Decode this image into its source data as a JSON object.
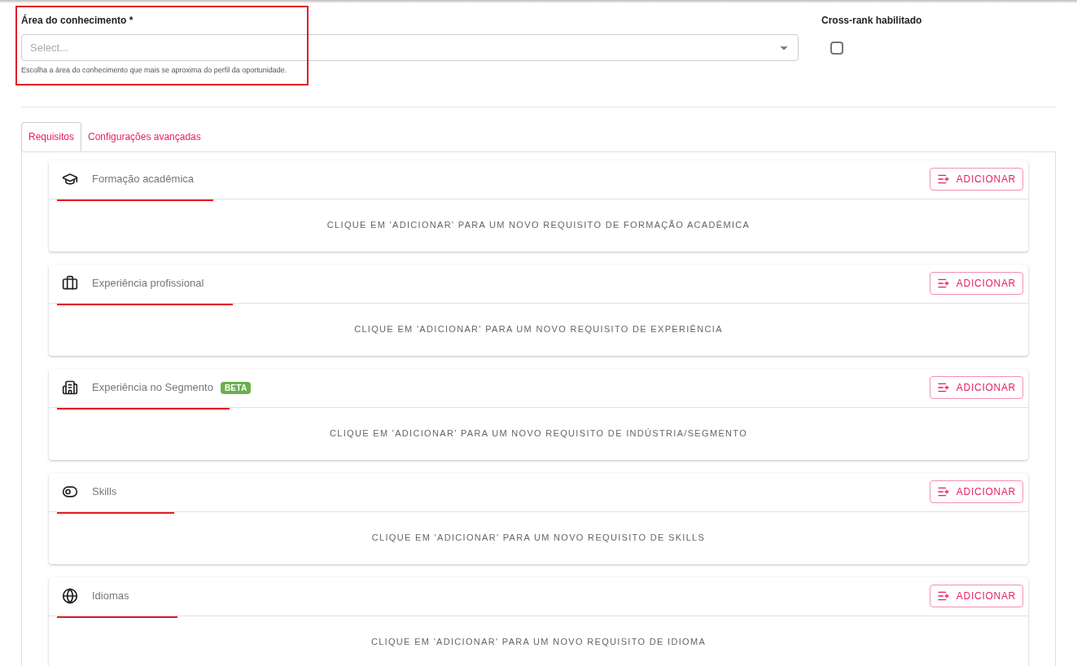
{
  "area_field": {
    "label": "Área do conhecimento *",
    "placeholder": "Select...",
    "helper": "Escolha a área do conhecimento que mais se aproxima do perfil da oportunidade.",
    "annotated": true
  },
  "cross_rank": {
    "label": "Cross-rank habilitado",
    "checked": false
  },
  "tabs": [
    {
      "label": "Requisitos",
      "selected": true
    },
    {
      "label": "Configurações avançadas",
      "selected": false
    }
  ],
  "sections": [
    {
      "kind": "education",
      "title": "Formação acadêmica",
      "button": "ADICIONAR",
      "empty_text": "CLIQUE EM 'ADICIONAR' PARA UM NOVO REQUISITO DE FORMAÇÃO ACADÊMICA",
      "annotated": true
    },
    {
      "kind": "experience",
      "title": "Experiência profissional",
      "button": "ADICIONAR",
      "empty_text": "CLIQUE EM 'ADICIONAR' PARA UM NOVO REQUISITO DE EXPERIÊNCIA",
      "annotated": true
    },
    {
      "kind": "segment",
      "title": "Experiência no Segmento",
      "badge": "BETA",
      "button": "ADICIONAR",
      "empty_text": "CLIQUE EM 'ADICIONAR' PARA UM NOVO REQUISITO DE INDÚSTRIA/SEGMENTO",
      "annotated": true
    },
    {
      "kind": "skills",
      "title": "Skills",
      "button": "ADICIONAR",
      "empty_text": "CLIQUE EM 'ADICIONAR' PARA UM NOVO REQUISITO DE SKILLS",
      "annotated": true
    },
    {
      "kind": "languages",
      "title": "Idiomas",
      "button": "ADICIONAR",
      "empty_text": "CLIQUE EM 'ADICIONAR' PARA UM NOVO REQUISITO DE IDIOMA",
      "annotated": true
    }
  ]
}
